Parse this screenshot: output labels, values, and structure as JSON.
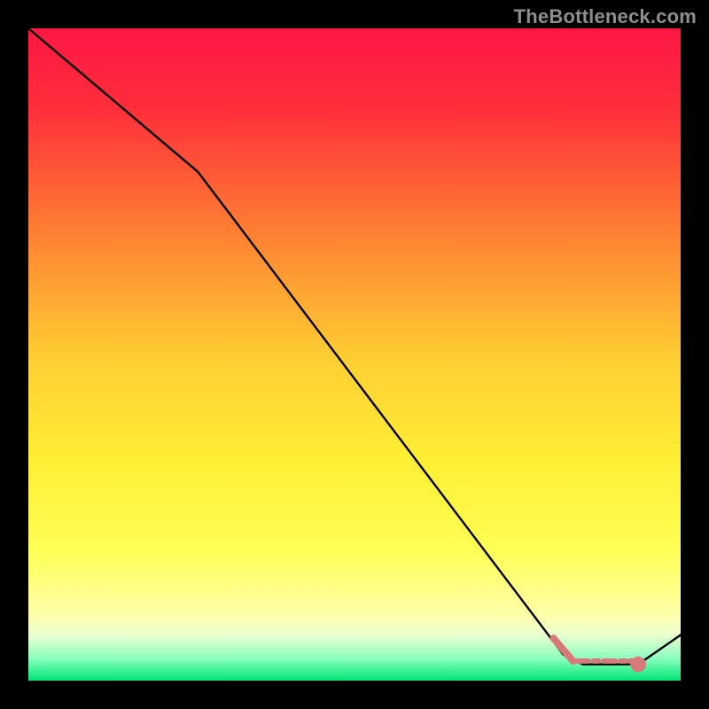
{
  "watermark": "TheBottleneck.com",
  "chart_data": {
    "type": "line",
    "title": "",
    "xlabel": "",
    "ylabel": "",
    "xlim": [
      0,
      100
    ],
    "ylim": [
      0,
      100
    ],
    "grid": false,
    "gradient_stops": [
      {
        "pos": 0.0,
        "color": "#ff1744"
      },
      {
        "pos": 0.12,
        "color": "#ff2d3a"
      },
      {
        "pos": 0.3,
        "color": "#ff7a33"
      },
      {
        "pos": 0.5,
        "color": "#ffcc33"
      },
      {
        "pos": 0.66,
        "color": "#ffee33"
      },
      {
        "pos": 0.8,
        "color": "#ffff55"
      },
      {
        "pos": 0.9,
        "color": "#ffffaa"
      },
      {
        "pos": 0.93,
        "color": "#eaffd0"
      },
      {
        "pos": 0.965,
        "color": "#8effc0"
      },
      {
        "pos": 1.0,
        "color": "#00e676"
      }
    ],
    "series": [
      {
        "name": "curve",
        "stroke": "#000000",
        "points": [
          {
            "x": 0.0,
            "y": 100.0
          },
          {
            "x": 26.0,
            "y": 78.0
          },
          {
            "x": 82.0,
            "y": 4.0
          },
          {
            "x": 85.0,
            "y": 2.5
          },
          {
            "x": 93.5,
            "y": 2.5
          },
          {
            "x": 100.0,
            "y": 7.0
          }
        ]
      }
    ],
    "markers": {
      "stroke": "#d87a7a",
      "end_dot": {
        "x": 93.5,
        "y": 2.5,
        "r": 1.2
      },
      "entry_segment": [
        {
          "x": 80.5,
          "y": 6.5
        },
        {
          "x": 83.5,
          "y": 3.0
        }
      ],
      "dashes": [
        {
          "x1": 84.0,
          "x2": 85.8,
          "y": 3.0
        },
        {
          "x1": 86.6,
          "x2": 87.4,
          "y": 3.0
        },
        {
          "x1": 88.2,
          "x2": 90.0,
          "y": 3.0
        },
        {
          "x1": 90.8,
          "x2": 91.6,
          "y": 3.0
        },
        {
          "x1": 92.2,
          "x2": 93.2,
          "y": 3.0
        }
      ]
    }
  }
}
